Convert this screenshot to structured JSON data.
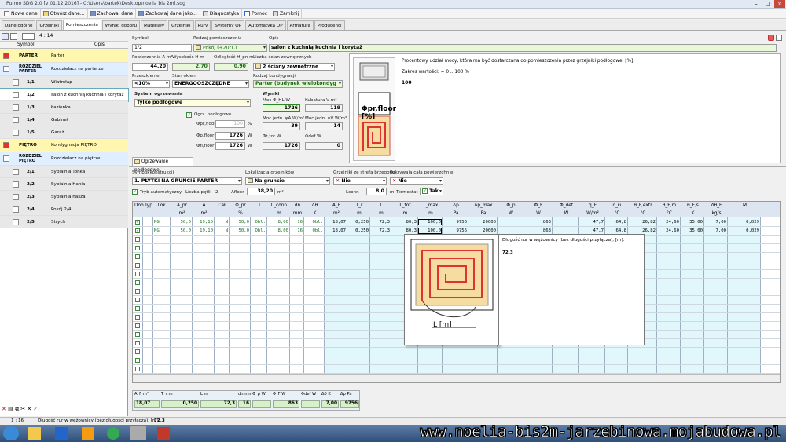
{
  "app": {
    "title": "Purmo SDG 2.0  [v 01.12.2016] - C:\\Users\\bartek\\Desktop\\noelia bis 2ml.sdg"
  },
  "toolbar": [
    {
      "label": "Nowe dane",
      "icon": "new-file-icon"
    },
    {
      "label": "Otwórz dane...",
      "icon": "open-folder-icon"
    },
    {
      "label": "Zachowaj dane",
      "icon": "save-icon"
    },
    {
      "label": "Zachowaj dane jako...",
      "icon": "save-as-icon"
    },
    {
      "label": "Diagnostyka",
      "icon": "diagnostics-icon"
    },
    {
      "label": "Pomoc",
      "icon": "help-icon"
    },
    {
      "label": "Zamknij",
      "icon": "close-icon"
    }
  ],
  "tabs": [
    "Dane ogólne",
    "Grzejniki",
    "Pomieszczenia",
    "Wyniki doboru",
    "Materiały",
    "Grzejniki",
    "Rury",
    "Systemy OP",
    "Automatyka OP",
    "Armatura",
    "Producenci"
  ],
  "left": {
    "counter": "4 : 14",
    "col_symbol": "Symbol",
    "col_opis": "Opis",
    "rows": [
      {
        "sym": "PARTER",
        "opis": "Parter",
        "type": "floor"
      },
      {
        "sym": "ROZDZIEL PARTER",
        "opis": "Rozdzielacz na parterze",
        "type": "dist"
      },
      {
        "sym": "1/1",
        "opis": "Wiatrołap",
        "type": "room"
      },
      {
        "sym": "1/2",
        "opis": "salon z kuchnią kuchnia i korytaż",
        "type": "sel"
      },
      {
        "sym": "1/3",
        "opis": "Łazienka",
        "type": "room"
      },
      {
        "sym": "1/4",
        "opis": "Gabinet",
        "type": "room"
      },
      {
        "sym": "1/5",
        "opis": "Garaż",
        "type": "room"
      },
      {
        "sym": "PIĘTRO",
        "opis": "Kondygnacja PIĘTRO",
        "type": "floor"
      },
      {
        "sym": "ROZDZIEL PIĘTRO",
        "opis": "Rozdzielacz na piętrze",
        "type": "dist"
      },
      {
        "sym": "2/1",
        "opis": "Sypialnia Tonka",
        "type": "room"
      },
      {
        "sym": "2/2",
        "opis": "Sypialnia Hania",
        "type": "room"
      },
      {
        "sym": "2/3",
        "opis": "Sypialnia nasza",
        "type": "room"
      },
      {
        "sym": "2/4",
        "opis": "Pokój 2/4",
        "type": "room"
      },
      {
        "sym": "2/5",
        "opis": "Strych",
        "type": "room"
      }
    ]
  },
  "form": {
    "symbol_label": "Symbol",
    "symbol": "1/2",
    "rodzaj_label": "Rodzaj pomieszczenia",
    "rodzaj": "Pokój (+20°C)",
    "opis_label": "Opis",
    "opis": "salon z kuchnią kuchnia i korytaż",
    "pow_label": "Powierzchnia A m²",
    "pow": "44,20",
    "wys_label": "Wysokość H m",
    "wys": "2,70",
    "odl_label": "Odległość H_pn m",
    "odl": "0,90",
    "sciany_label": "Liczba ścian zewnętrznych",
    "sciany": "2 ściany zewnętrzne",
    "przez_label": "Przeszklenie",
    "przez": "<10%",
    "stan_label": "Stan okien",
    "stan": "ENERGOOSZCZĘDNE",
    "kond_label": "Rodzaj kondygnacji",
    "kond": "Parter (budynek wielokondyg",
    "system_label": "System ogrzewania",
    "system": "Tylko podłogowe",
    "ogrz_podl": "Ogrz. podłogowe",
    "phi_pr_floor_label": "Φpr,floor",
    "phi_pr_floor": "100",
    "unit_pct": "%",
    "phi_p_floor_label": "Φp,floor",
    "phi_p_floor": "1726",
    "unit_w": "W",
    "phi_fl_floor_label": "Φfl,floor",
    "phi_fl_floor": "1726",
    "wyniki_label": "Wyniki",
    "moc_label": "Moc Φ_HL W",
    "moc": "1726",
    "kub_label": "Kubatura V m³",
    "kub": "119",
    "mocjedn_a_label": "Moc jedn. φA W/m²",
    "mocjedn_a": "39",
    "mocjedn_v_label": "Moc jedn. φV W/m³",
    "mocjedn_v": "14",
    "phi_tot_label": "Φt,tot W",
    "phi_tot": "1726",
    "phi_def_label": "Φdef W",
    "phi_def": "0"
  },
  "info": {
    "text": "Procentowy udział mocy, która ma być dostarczana do pomieszczenia przez grzejniki podłogowe, [%].",
    "range": "Zakres wartości: = 0 .. 100 %",
    "value": "100",
    "figure_label": "Φpr,floor [%]"
  },
  "subtab": "Ogrzewanie podłogowe",
  "floor": {
    "konstr_label": "Symbol konstrukcji",
    "konstr": "1. PŁYTKI NA GRUNCIE PARTER",
    "lok_label": "Lokalizacja grzejników",
    "lok": "Na gruncie",
    "strefa_label": "Grzejniki ze strefą brzegową",
    "strefa": "Nie",
    "pokr_label": "Pokrywają całą powierzchnię",
    "pokr": "Nie",
    "tryb": "Tryb automatyczny",
    "petli_label": "Liczba pętli:",
    "petli": "2",
    "afloor_label": "Afloor",
    "afloor": "38,20",
    "afloor_unit": "m²",
    "lconn_label": "Lconn",
    "lconn": "8,0",
    "lconn_unit": "m",
    "termostat_label": "Termostat",
    "termostat": "Tak"
  },
  "grid": {
    "headers": [
      "Dob",
      "Typ",
      "Lok.",
      "A_pr",
      "A",
      "Cał.",
      "Φ_pr",
      "T",
      "L_conn",
      "dn",
      "Δθ",
      "A_F",
      "T_r",
      "L",
      "L_tot",
      "L_max",
      "Δp",
      "Δp_max",
      "Φ_p",
      "Φ_F",
      "Φ_def",
      "q_F",
      "q_G",
      "θ_F,extr",
      "θ_F,m",
      "θ_F,s",
      "Δθ_F",
      "M"
    ],
    "units": [
      "",
      "",
      "",
      "m²",
      "m²",
      "",
      "%",
      "",
      "m",
      "mm",
      "K",
      "m²",
      "m",
      "m",
      "m",
      "m",
      "Pa",
      "Pa",
      "W",
      "W",
      "W",
      "W/m²",
      "°C",
      "°C",
      "°C",
      "K",
      "kg/s"
    ],
    "rows": [
      [
        "",
        "",
        "NG",
        "50,0",
        "19,10",
        "N",
        "50,0",
        "Obl.",
        "8,00",
        "16",
        "Obl.",
        "18,07",
        "0,250",
        "72,3",
        "80,3",
        "100,0",
        "9756",
        "20000",
        "",
        "863",
        "",
        "47,7",
        "64,8",
        "26,82",
        "24,60",
        "35,00",
        "7,00",
        "0,029"
      ],
      [
        "",
        "",
        "NG",
        "50,0",
        "19,10",
        "N",
        "50,0",
        "Obl.",
        "8,00",
        "16",
        "Obl.",
        "18,07",
        "0,250",
        "72,3",
        "80,3",
        "100,0",
        "9756",
        "20000",
        "",
        "863",
        "",
        "47,7",
        "64,8",
        "26,82",
        "24,60",
        "35,00",
        "7,00",
        "0,029"
      ]
    ]
  },
  "tooltip": {
    "text": "Długość rur w wężownicy (bez długości przyłącza), [m].",
    "value": "72,3",
    "figure_label": "L [m]"
  },
  "summary": {
    "labels": [
      "A_F m²",
      "T_r m",
      "L m",
      "dn mm",
      "Φ_p W",
      "Φ_F W",
      "Φdef W",
      "Δθ K",
      "Δp Pa"
    ],
    "values": [
      "18,07",
      "0,250",
      "72,3",
      "16",
      "",
      "863",
      "",
      "7,00",
      "9756"
    ]
  },
  "status": {
    "pos": "1 : 16",
    "text": "Długość rur w wężownicy (bez długości przyłącza), [m].",
    "value": "72,3"
  },
  "watermark": "www.noelia-bis2m-jarzebinowa.mojabudowa.pl",
  "colors": {
    "accent_green": "#e8f8d8",
    "selected_row": "#dff3ff",
    "floor_row": "#fff6b0"
  }
}
